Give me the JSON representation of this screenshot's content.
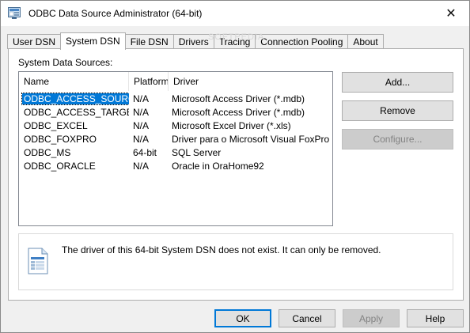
{
  "window": {
    "title": "ODBC Data Source Administrator (64-bit)",
    "close_glyph": "✕",
    "app_icon": "odbc-app-icon",
    "watermark": "SOFTPEDIA"
  },
  "tabs": [
    {
      "label": "User DSN",
      "active": false
    },
    {
      "label": "System DSN",
      "active": true
    },
    {
      "label": "File DSN",
      "active": false
    },
    {
      "label": "Drivers",
      "active": false
    },
    {
      "label": "Tracing",
      "active": false
    },
    {
      "label": "Connection Pooling",
      "active": false
    },
    {
      "label": "About",
      "active": false
    }
  ],
  "system_dsn": {
    "section_label": "System Data Sources:",
    "columns": [
      "Name",
      "Platform",
      "Driver"
    ],
    "rows": [
      {
        "name": "ODBC_ACCESS_SOURCE",
        "platform": "N/A",
        "driver": "Microsoft Access Driver (*.mdb)",
        "selected": true
      },
      {
        "name": "ODBC_ACCESS_TARGET",
        "platform": "N/A",
        "driver": "Microsoft Access Driver (*.mdb)",
        "selected": false
      },
      {
        "name": "ODBC_EXCEL",
        "platform": "N/A",
        "driver": "Microsoft Excel Driver (*.xls)",
        "selected": false
      },
      {
        "name": "ODBC_FOXPRO",
        "platform": "N/A",
        "driver": "Driver para o Microsoft Visual FoxPro",
        "selected": false
      },
      {
        "name": "ODBC_MS",
        "platform": "64-bit",
        "driver": "SQL Server",
        "selected": false
      },
      {
        "name": "ODBC_ORACLE",
        "platform": "N/A",
        "driver": "Oracle in OraHome92",
        "selected": false
      }
    ],
    "buttons": {
      "add": "Add...",
      "remove": "Remove",
      "configure": "Configure..."
    },
    "info": {
      "icon": "data-source-document-icon",
      "text": "The driver of this 64-bit System DSN does not exist. It can only be removed."
    }
  },
  "footer": {
    "ok": "OK",
    "cancel": "Cancel",
    "apply": "Apply",
    "help": "Help"
  },
  "colors": {
    "selection": "#0078d7",
    "default_button_border": "#0078d7",
    "disabled_text": "#838383"
  }
}
